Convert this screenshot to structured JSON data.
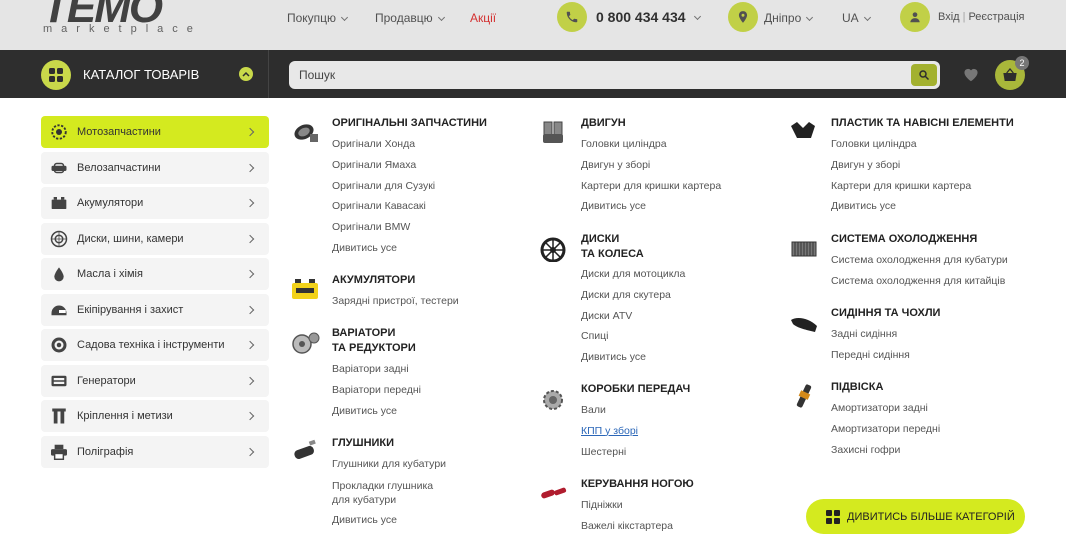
{
  "header": {
    "logo_word": "TEMO",
    "logo_sub": "marketplace",
    "nav": [
      {
        "label": "Покупцю"
      },
      {
        "label": "Продавцю"
      },
      {
        "label": "Акції"
      }
    ],
    "phone": "0 800 434 434",
    "city": "Дніпро",
    "lang": "UA",
    "login": "Вхід",
    "register": "Реєстрація"
  },
  "toolbar": {
    "catalog_label": "КАТАЛОГ ТОВАРІВ",
    "search_placeholder": "Пошук",
    "cart_count": "2"
  },
  "sidebar": {
    "items": [
      {
        "label": "Мотозапчастини",
        "icon": "gear-icon",
        "active": true
      },
      {
        "label": "Велозапчастини",
        "icon": "bike-part-icon"
      },
      {
        "label": "Акумулятори",
        "icon": "battery-icon"
      },
      {
        "label": "Диски, шини, камери",
        "icon": "wheel-icon"
      },
      {
        "label": "Масла і хімія",
        "icon": "oil-drop-icon"
      },
      {
        "label": "Екіпірування і захист",
        "icon": "helmet-icon"
      },
      {
        "label": "Садова техніка і інструменти",
        "icon": "saw-blade-icon"
      },
      {
        "label": "Генератори",
        "icon": "generator-icon"
      },
      {
        "label": "Кріплення і метизи",
        "icon": "bolt-icon"
      },
      {
        "label": "Поліграфія",
        "icon": "printer-icon"
      }
    ]
  },
  "menu": {
    "col1": [
      {
        "title": "ОРИГІНАЛЬНІ ЗАПЧАСТИНИ",
        "icon": "air-filter-icon",
        "links": [
          "Оригінали Хонда",
          "Оригінали Ямаха",
          "Оригінали для Сузукі",
          "Оригінали Кавасакі",
          "Оригінали BMW",
          "Дивитись усе"
        ]
      },
      {
        "title": "АКУМУЛЯТОРИ",
        "icon": "battery-icon",
        "links": [
          "Зарядні пристрої, тестери"
        ]
      },
      {
        "title_l1": "ВАРІАТОРИ",
        "title_l2": "ТА РЕДУКТОРИ",
        "icon": "variator-icon",
        "links": [
          "Варіатори задні",
          "Варіатори передні",
          "Дивитись усе"
        ]
      },
      {
        "title": "ГЛУШНИКИ",
        "icon": "muffler-icon",
        "links_a": [
          "Глушники для кубатури"
        ],
        "link_two_l1": "Прокладки глушника",
        "link_two_l2": "для кубатури",
        "links_b": [
          "Дивитись усе"
        ]
      }
    ],
    "col2": [
      {
        "title": "ДВИГУН",
        "icon": "engine-icon",
        "links": [
          "Головки циліндра",
          "Двигун у зборі",
          "Картери для кришки картера",
          "Дивитись усе"
        ]
      },
      {
        "title_l1": "ДИСКИ",
        "title_l2": "ТА КОЛЕСА",
        "icon": "rim-icon",
        "links": [
          "Диски для мотоцикла",
          "Диски для скутера",
          "Диски ATV",
          "Спиці",
          "Дивитись усе"
        ]
      },
      {
        "title": "КОРОБКИ ПЕРЕДАЧ",
        "icon": "gearbox-icon",
        "links": [
          "Вали",
          "КПП у зборі",
          "Шестерні"
        ]
      },
      {
        "title": "КЕРУВАННЯ НОГОЮ",
        "icon": "pedal-icon",
        "links": [
          "Підніжки",
          "Важелі кікстартера"
        ]
      }
    ],
    "col3": [
      {
        "title": "ПЛАСТИК ТА НАВІСНІ ЕЛЕМЕНТИ",
        "icon": "fairing-icon",
        "links": [
          "Головки циліндра",
          "Двигун у зборі",
          "Картери для кришки картера",
          "Дивитись усе"
        ]
      },
      {
        "title": "СИСТЕМА ОХОЛОДЖЕННЯ",
        "icon": "radiator-icon",
        "links": [
          "Система охолодження для кубатури",
          "Система охолодження для китайців"
        ]
      },
      {
        "title": "СИДІННЯ ТА ЧОХЛИ",
        "icon": "seat-icon",
        "links": [
          "Задні сидіння",
          "Передні сидіння"
        ]
      },
      {
        "title": "ПІДВІСКА",
        "icon": "shock-icon",
        "links": [
          "Амортизатори задні",
          "Амортизатори передні",
          "Захисні гофри"
        ]
      }
    ]
  },
  "more_button": "ДИВИТИСЬ БІЛЬШЕ КАТЕГОРІЙ",
  "colors": {
    "accent": "#d4ea1f",
    "dark": "#2d2d2d",
    "link_active": "#2a66b8",
    "promo": "#d33"
  }
}
